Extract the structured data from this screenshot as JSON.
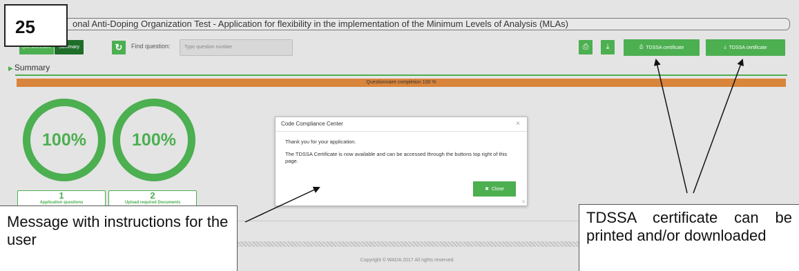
{
  "step_number": "25",
  "window_title": "onal Anti-Doping Organization Test - Application for flexibility in the implementation of the Minimum Levels of Analysis (MLAs)",
  "toolbar": {
    "questionnaire_label": "Questionnaire",
    "summary_label": "Summary",
    "find_label": "Find question:",
    "find_placeholder": "Type question number",
    "tdssa_print_label": "TDSSA certificate",
    "tdssa_download_label": "TDSSA certificate"
  },
  "section_title": "Summary",
  "progress": {
    "label": "Questionnaire completion 100 %",
    "value": 100
  },
  "rings": [
    {
      "value": "100%"
    },
    {
      "value": "100%"
    }
  ],
  "stats": [
    {
      "count": "1",
      "label": "Application questions"
    },
    {
      "count": "2",
      "label": "Upload required Documents"
    }
  ],
  "modal": {
    "title": "Code Compliance Center",
    "close_x": "×",
    "line1": "Thank you for your application.",
    "line2": "The TDSSA Certificate is now available and can be accessed through the buttons top right of this page.",
    "close_label": "Close"
  },
  "footer": {
    "copyright": "Copyright © WADA 2017 All rights reserved."
  },
  "annotations": {
    "left": "Message with instructions for the user",
    "right": "TDSSA certificate can be printed and/or downloaded"
  },
  "colors": {
    "accent": "#4caf50",
    "dark_accent": "#1e6e2a",
    "progress": "#d9853b"
  },
  "icons": [
    "refresh-icon",
    "print-icon",
    "download-icon",
    "close-icon"
  ]
}
